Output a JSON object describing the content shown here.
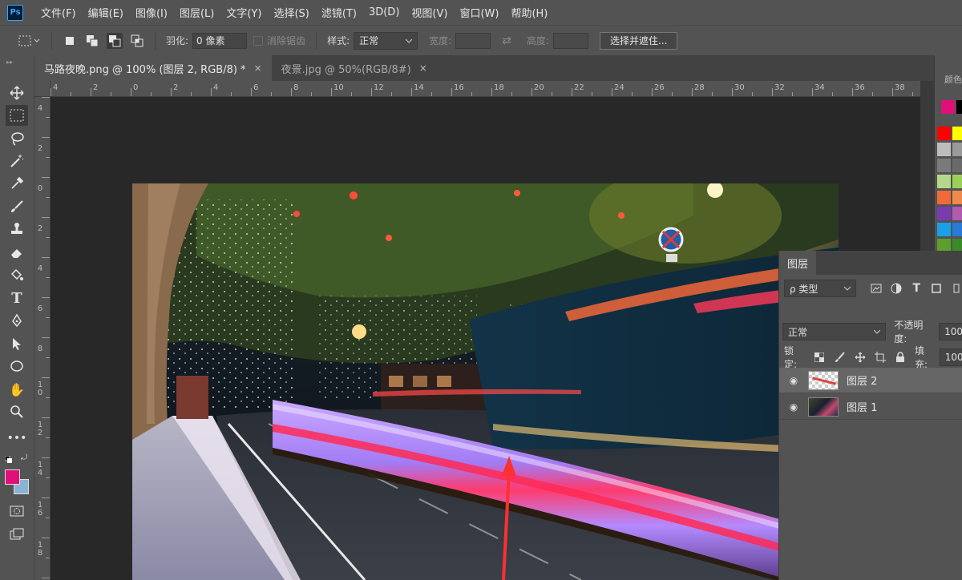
{
  "app": {
    "logo": "Ps"
  },
  "menu": [
    "文件(F)",
    "编辑(E)",
    "图像(I)",
    "图层(L)",
    "文字(Y)",
    "选择(S)",
    "滤镜(T)",
    "3D(D)",
    "视图(V)",
    "窗口(W)",
    "帮助(H)"
  ],
  "options": {
    "feather_label": "羽化:",
    "feather_value": "0 像素",
    "antialias_label": "消除锯齿",
    "style_label": "样式:",
    "style_value": "正常",
    "width_label": "宽度:",
    "height_label": "高度:",
    "select_mask_button": "选择并遮住..."
  },
  "tabs": [
    {
      "label": "马路夜晚.png @ 100% (图层 2, RGB/8) *",
      "close": "×"
    },
    {
      "label": "夜景.jpg @ 50%(RGB/8#)",
      "close": "×"
    }
  ],
  "ruler_top": [
    "4",
    "2",
    "0",
    "2",
    "4",
    "6",
    "8",
    "10",
    "12",
    "14",
    "16",
    "18",
    "20",
    "22",
    "24",
    "26",
    "28",
    "30",
    "32",
    "34",
    "36",
    "38"
  ],
  "ruler_left": [
    "4",
    "2",
    "0",
    "2",
    "4",
    "6",
    "8",
    "1 0",
    "1 2",
    "1 4",
    "1 6",
    "1 8"
  ],
  "layers_panel": {
    "title": "图层",
    "filter_value": "ρ 类型",
    "blend_mode": "正常",
    "opacity_label": "不透明度:",
    "opacity_value": "100",
    "lock_label": "锁定:",
    "fill_label": "填充:",
    "fill_value": "100",
    "layers": [
      {
        "name": "图层 2",
        "selected": true
      },
      {
        "name": "图层 1",
        "selected": false
      }
    ]
  },
  "colors": {
    "foreground": "#e0107a",
    "background": "#8ab4d4",
    "swatch_panel_label": "颜色"
  }
}
